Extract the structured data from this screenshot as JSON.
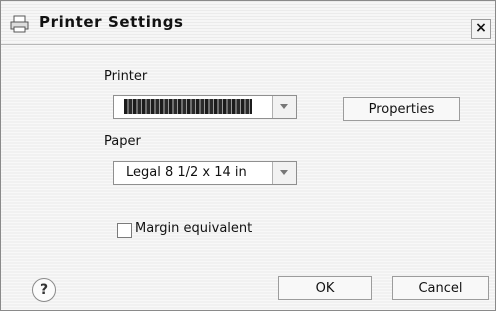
{
  "dialog": {
    "title": "Printer Settings",
    "title_icon": "printer-icon",
    "close_label": "×"
  },
  "printer": {
    "label": "Printer",
    "selected_value": "",
    "value_obscured": true,
    "properties_label": "Properties"
  },
  "paper": {
    "label": "Paper",
    "selected_value": "Legal 8 1/2 x 14 in"
  },
  "margin": {
    "label": "Margin equivalent",
    "checked": false
  },
  "footer": {
    "help_label": "?",
    "ok_label": "OK",
    "cancel_label": "Cancel"
  }
}
